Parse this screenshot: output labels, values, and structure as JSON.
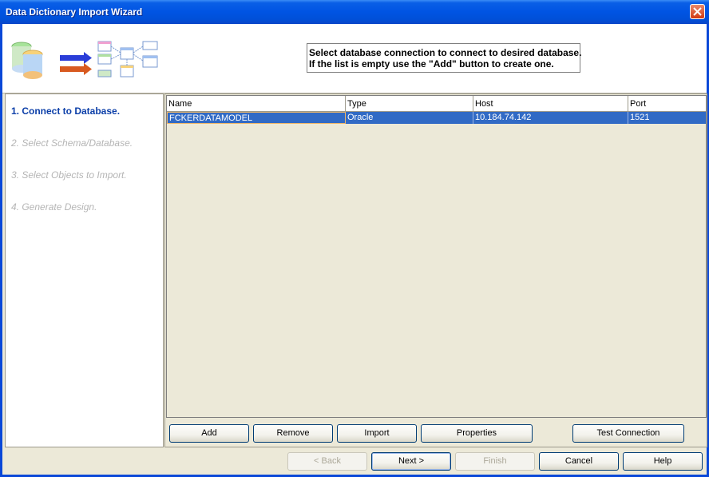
{
  "window": {
    "title": "Data Dictionary Import Wizard"
  },
  "header": {
    "instruction_line1": "Select database connection to connect to desired database.",
    "instruction_line2": "If the list is empty use the \"Add\" button to create one."
  },
  "steps": [
    {
      "label": "1. Connect to Database.",
      "active": true
    },
    {
      "label": "2. Select Schema/Database.",
      "active": false
    },
    {
      "label": "3. Select Objects to Import.",
      "active": false
    },
    {
      "label": "4. Generate Design.",
      "active": false
    }
  ],
  "connections_table": {
    "columns": [
      "Name",
      "Type",
      "Host",
      "Port"
    ],
    "rows": [
      {
        "name": "FCKERDATAMODEL",
        "type": "Oracle",
        "host": "10.184.74.142",
        "port": "1521",
        "selected": true
      }
    ]
  },
  "table_buttons": {
    "add": "Add",
    "remove": "Remove",
    "import": "Import",
    "properties": "Properties",
    "test_connection": "Test Connection"
  },
  "footer_buttons": {
    "back": "< Back",
    "next": "Next >",
    "finish": "Finish",
    "cancel": "Cancel",
    "help": "Help"
  },
  "colors": {
    "titlebar": "#0054e3",
    "selection": "#316ac5",
    "active_step": "#0b3ea8",
    "inactive_step": "#b5b5b5"
  }
}
